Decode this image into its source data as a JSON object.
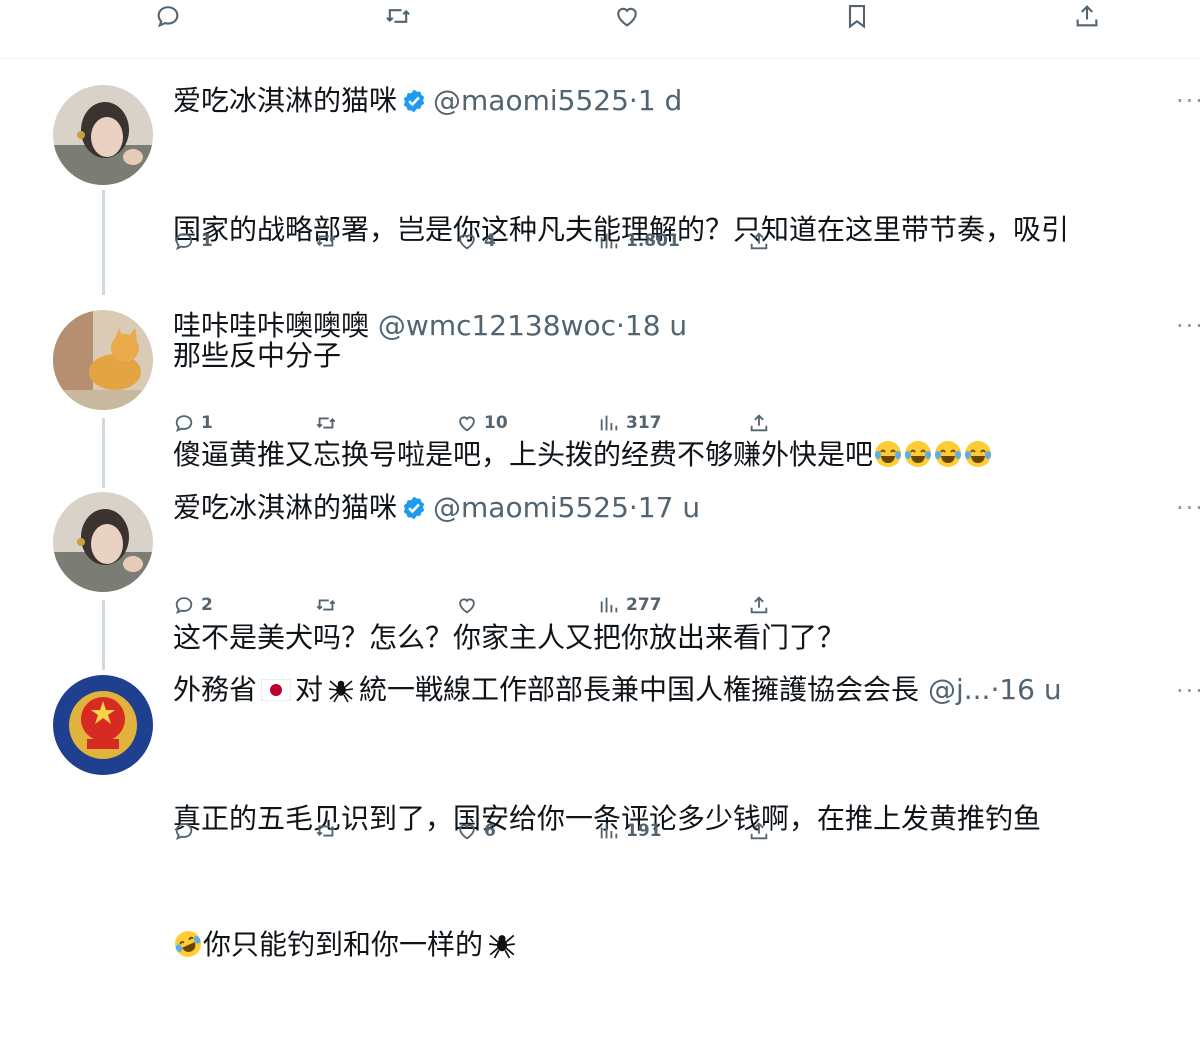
{
  "top_actions": [
    "reply-icon",
    "retweet-icon",
    "like-icon",
    "bookmark-icon",
    "share-icon"
  ],
  "colors": {
    "verified": "#1d9bf0",
    "text": "#0f1419",
    "muted": "#536471",
    "thread_line": "#cfd9de"
  },
  "tweets": [
    {
      "name": "爱吃冰淇淋的猫咪",
      "verified": true,
      "handle": "@maomi5525",
      "sep": "·",
      "time": "1 d",
      "line1": "国家的战略部署，岂是你这种凡夫能理解的？只知道在这里带节奏，吸引",
      "line2": "那些反中分子",
      "replies": "1",
      "retweets": "",
      "likes": "4",
      "views": "1.801"
    },
    {
      "name": "哇咔哇咔噢噢噢",
      "verified": false,
      "handle": "@wmc12138woc",
      "sep": "·",
      "time": "18 u",
      "line1": "傻逼黄推又忘换号啦是吧，上头拨的经费不够赚外快是吧",
      "line1_emoji": "laughing-tears x4",
      "replies": "1",
      "retweets": "",
      "likes": "10",
      "views": "317"
    },
    {
      "name": "爱吃冰淇淋的猫咪",
      "verified": true,
      "handle": "@maomi5525",
      "sep": "·",
      "time": "17 u",
      "line1": "这不是美犬吗？怎么？你家主人又把你放出来看门了？",
      "replies": "2",
      "retweets": "",
      "likes": "",
      "views": "277"
    },
    {
      "name_a": "外務省",
      "name_b": "对",
      "name_c": "統一戦線工作部部長兼中国人権擁護協会会長",
      "verified": false,
      "handle": "@j...",
      "sep": "·",
      "time": "16 u",
      "line1": "真正的五毛见识到了，国安给你一条评论多少钱啊，在推上发黄推钓鱼",
      "line2": "你只能钓到和你一样的",
      "replies": "",
      "retweets": "",
      "likes": "6",
      "views": "191"
    }
  ]
}
